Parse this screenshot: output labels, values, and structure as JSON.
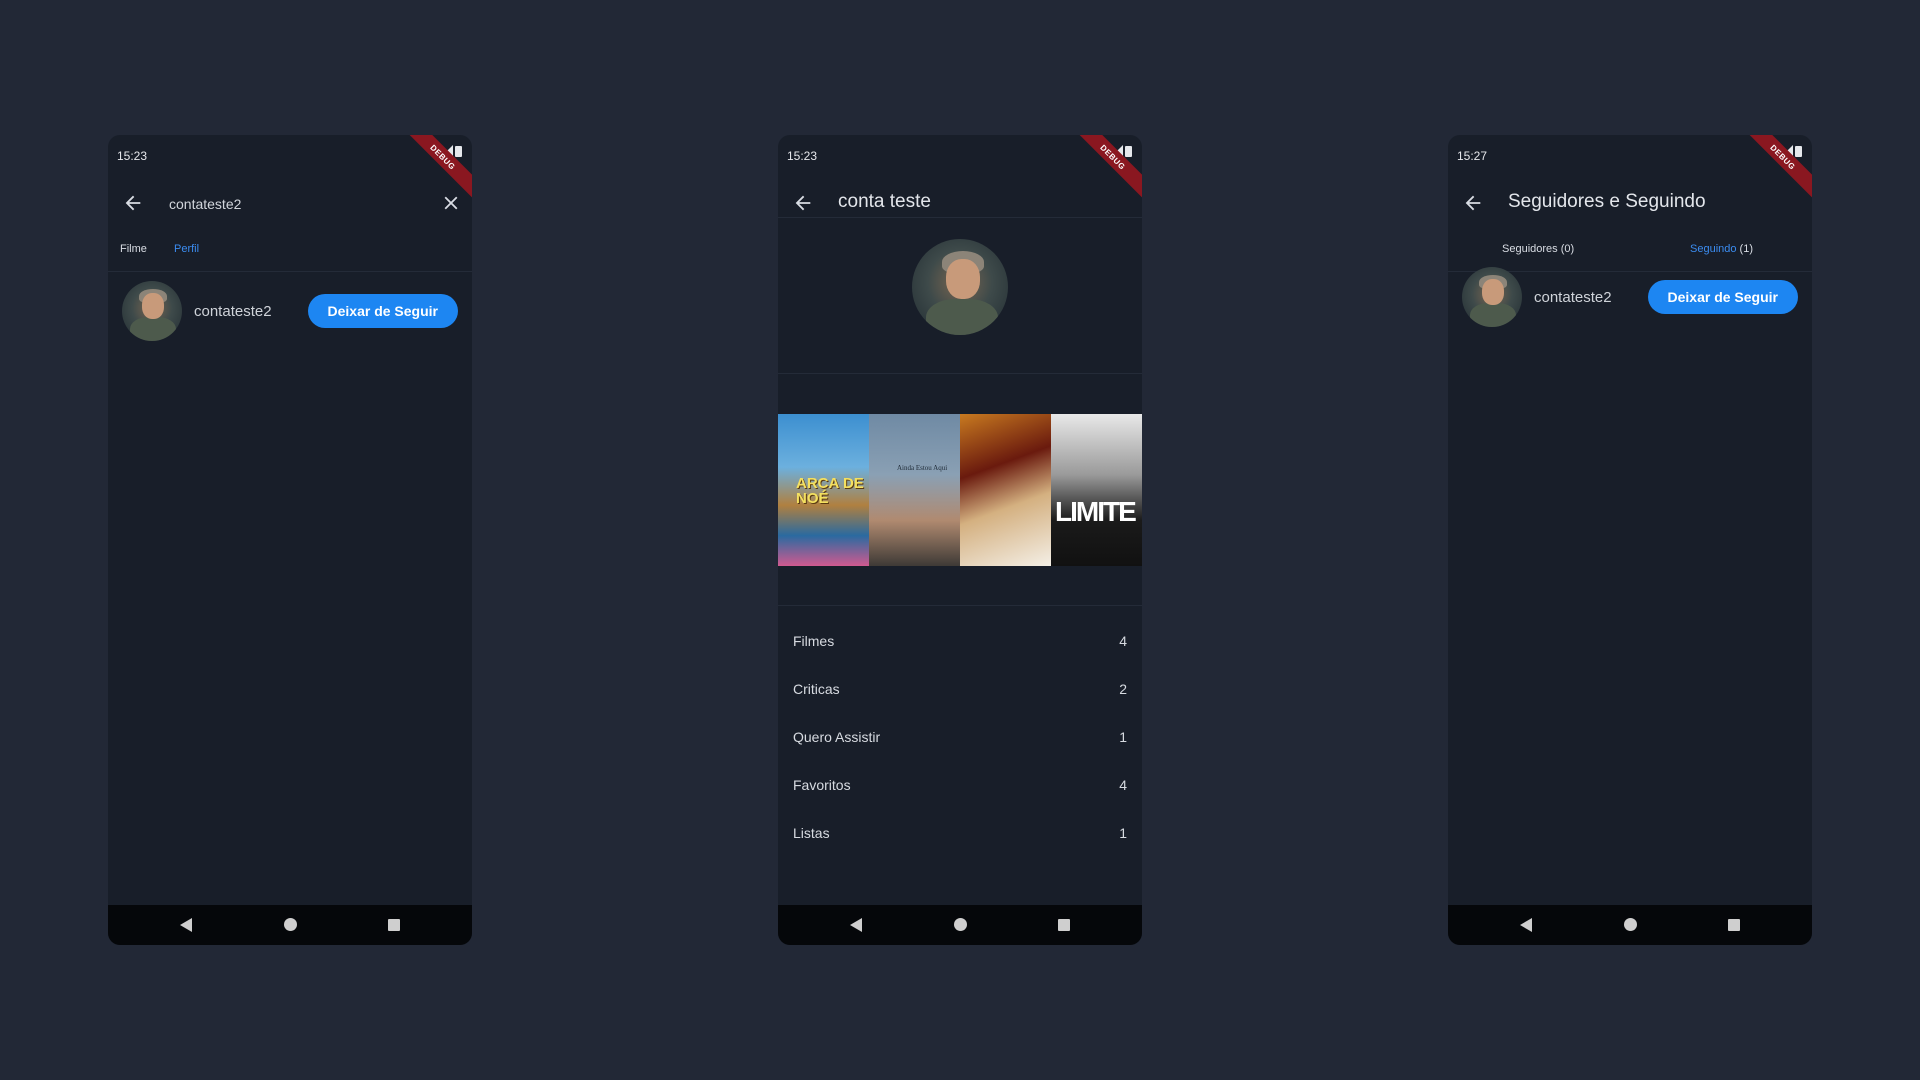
{
  "screens": [
    {
      "status_time": "15:23",
      "search_query": "contateste2",
      "tabs": [
        "Filme",
        "Perfil"
      ],
      "active_tab": "Perfil",
      "result": {
        "username": "contateste2",
        "button_label": "Deixar de Seguir"
      }
    },
    {
      "status_time": "15:23",
      "title": "conta teste",
      "posters": [
        {
          "text": "ARCA DE NOÉ"
        },
        {
          "text": "Ainda Estou Aqui"
        },
        {
          "text": ""
        },
        {
          "text": "LIMITE"
        }
      ],
      "stats": [
        {
          "label": "Filmes",
          "value": "4"
        },
        {
          "label": "Criticas",
          "value": "2"
        },
        {
          "label": "Quero Assistir",
          "value": "1"
        },
        {
          "label": "Favoritos",
          "value": "4"
        },
        {
          "label": "Listas",
          "value": "1"
        }
      ]
    },
    {
      "status_time": "15:27",
      "title": "Seguidores e Seguindo",
      "tab_followers": "Seguidores (0)",
      "tab_following_label": "Seguindo",
      "tab_following_count": " (1)",
      "active_tab": "Seguindo",
      "result": {
        "username": "contateste2",
        "button_label": "Deixar de Seguir"
      }
    }
  ],
  "debug_banner": "DEBUG",
  "icons": [
    "back-arrow-icon",
    "close-icon",
    "wifi-icon",
    "signal-icon",
    "battery-icon",
    "nav-back-icon",
    "nav-home-icon",
    "nav-recents-icon"
  ],
  "colors": {
    "background": "#222836",
    "screen": "#181e29",
    "accent": "#1d86f2",
    "active_tab": "#3b8cf0"
  }
}
